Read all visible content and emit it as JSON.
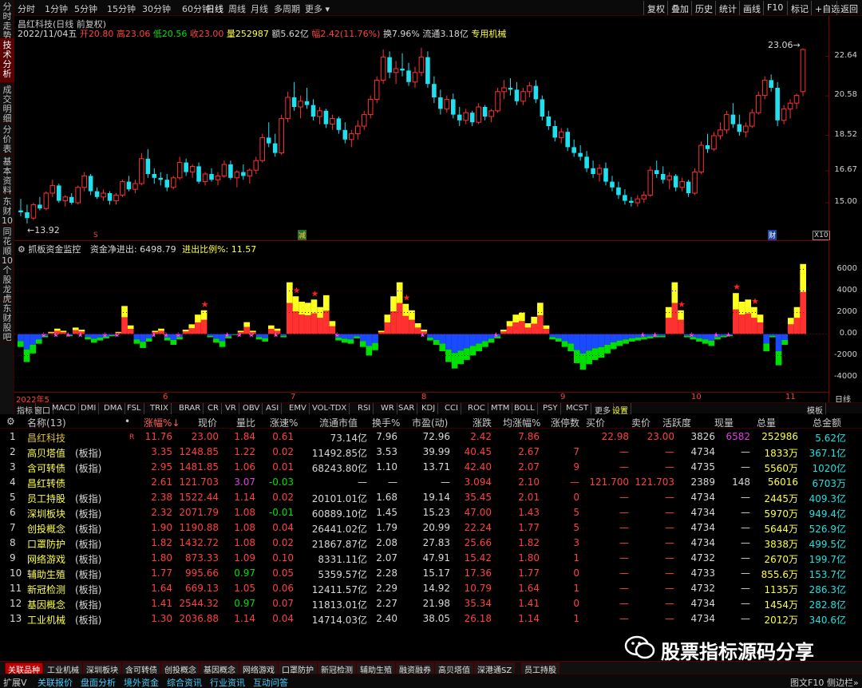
{
  "left_tabs": [
    "分时走势",
    "技术分析",
    "成交明细",
    "分价表",
    "基本资料",
    "东财10",
    "同花顺10",
    "个股龙虎",
    "东财股吧"
  ],
  "left_tab_active": 1,
  "toolbar": {
    "periods": [
      "分时",
      "1分钟",
      "5分钟",
      "15分钟",
      "30分钟",
      "60分钟",
      "日线",
      "周线",
      "月线",
      "多周期",
      "更多"
    ],
    "active_period": "日线",
    "right_buttons": [
      "复权",
      "叠加",
      "历史",
      "统计",
      "画线",
      "F10",
      "标记",
      "+自选",
      "返回"
    ]
  },
  "kline_info": {
    "title": "昌红科技(日线 前复权)",
    "date": "2022/11/04五",
    "open": "开20.80",
    "high": "高23.06",
    "low": "低20.56",
    "close": "收23.00",
    "volume": "量252987",
    "amount": "额5.62亿",
    "amp": "幅2.42(11.76%)",
    "turnover": "换7.96%",
    "float_cap": "流通3.18亿",
    "sector": "专用机械"
  },
  "kline_labels": {
    "max": "23.06",
    "min": "13.92",
    "x10": "X10",
    "mark_s": "S",
    "mark_jian": "减",
    "mark_cai": "财"
  },
  "price_ticks": [
    "22.64",
    "20.58",
    "18.52",
    "16.67",
    "15.00"
  ],
  "indicator": {
    "name": "抓板资金监控",
    "net_label": "资金净进出:",
    "net_value": "6498.79",
    "ratio_label": "进出比例%:",
    "ratio_value": "11.57",
    "ticks": [
      "6000",
      "4000",
      "2000",
      "0.00",
      "-2000",
      "-4000"
    ]
  },
  "time_axis": [
    "2022年5",
    "6",
    "7",
    "8",
    "9",
    "10",
    "11"
  ],
  "time_axis_right": "日线",
  "ind_tabs": [
    "指标",
    "窗口",
    "MACD",
    "DMI",
    "DMA",
    "FSL",
    "TRIX",
    "BRAR",
    "CR",
    "VR",
    "OBV",
    "ASI",
    "EMV",
    "VOL-TDX",
    "RSI",
    "WR",
    "SAR",
    "KDJ",
    "CCI",
    "ROC",
    "MTM",
    "BOLL",
    "PSY",
    "MCST",
    "更多",
    "设置"
  ],
  "ind_tab_right": "模板",
  "table": {
    "headers": [
      "名称(13)",
      "•",
      "涨幅%",
      "现价",
      "量比",
      "涨速%",
      "流通市值",
      "换手%",
      "市盈(动)",
      "涨跌",
      "均涨幅%",
      "涨停数",
      "买价",
      "卖价",
      "活跃度",
      "现量",
      "总量",
      "总金额"
    ],
    "rows": [
      [
        "1",
        "昌红科技",
        "R",
        "11.76",
        "23.00",
        "1.84",
        "0.61",
        "73.14亿",
        "7.96",
        "72.96",
        "2.42",
        "7.86",
        "",
        "22.98",
        "23.00",
        "3826",
        "6582",
        "252986",
        "5.62亿"
      ],
      [
        "2",
        "高贝塔值",
        "(板指)",
        "3.35",
        "1248.85",
        "1.22",
        "0.02",
        "11492.85亿",
        "3.53",
        "39.99",
        "40.45",
        "2.67",
        "7",
        "—",
        "—",
        "4734",
        "—",
        "1833万",
        "367.1亿"
      ],
      [
        "3",
        "含可转债",
        "(板指)",
        "2.95",
        "1481.85",
        "1.06",
        "0.01",
        "68243.80亿",
        "1.10",
        "13.71",
        "42.40",
        "2.07",
        "9",
        "—",
        "—",
        "4735",
        "—",
        "5560万",
        "1020亿"
      ],
      [
        "4",
        "昌红转债",
        "",
        "2.61",
        "121.703",
        "3.07",
        "-0.03",
        "—",
        "—",
        "—",
        "3.094",
        "2.10",
        "—",
        "121.700",
        "121.703",
        "2389",
        "148",
        "56016",
        "6703万"
      ],
      [
        "5",
        "员工持股",
        "(板指)",
        "2.38",
        "1522.44",
        "1.14",
        "0.02",
        "20101.01亿",
        "1.68",
        "19.14",
        "35.45",
        "2.01",
        "0",
        "—",
        "—",
        "4734",
        "—",
        "2445万",
        "409.3亿"
      ],
      [
        "6",
        "深圳板块",
        "(板指)",
        "2.32",
        "2071.79",
        "1.08",
        "-0.01",
        "60889.10亿",
        "1.45",
        "15.23",
        "47.00",
        "1.43",
        "5",
        "—",
        "—",
        "4734",
        "—",
        "5970万",
        "949.4亿"
      ],
      [
        "7",
        "创投概念",
        "(板指)",
        "1.90",
        "1190.88",
        "1.08",
        "0.04",
        "26441.02亿",
        "1.79",
        "20.99",
        "22.24",
        "1.77",
        "5",
        "—",
        "—",
        "4734",
        "—",
        "5644万",
        "526.9亿"
      ],
      [
        "8",
        "口罩防护",
        "(板指)",
        "1.82",
        "1432.72",
        "1.08",
        "0.02",
        "21867.87亿",
        "2.08",
        "27.83",
        "25.66",
        "1.82",
        "3",
        "—",
        "—",
        "4734",
        "—",
        "3838万",
        "499.5亿"
      ],
      [
        "9",
        "网络游戏",
        "(板指)",
        "1.80",
        "873.33",
        "1.09",
        "0.10",
        "8331.11亿",
        "2.07",
        "47.91",
        "15.42",
        "1.80",
        "1",
        "—",
        "—",
        "4732",
        "—",
        "2670万",
        "199.7亿"
      ],
      [
        "10",
        "辅助生殖",
        "(板指)",
        "1.77",
        "995.66",
        "0.97",
        "0.05",
        "5359.57亿",
        "2.28",
        "15.17",
        "17.36",
        "1.77",
        "0",
        "—",
        "—",
        "4733",
        "—",
        "855.6万",
        "153.7亿"
      ],
      [
        "11",
        "新冠检测",
        "(板指)",
        "1.64",
        "669.13",
        "1.05",
        "0.06",
        "12411.57亿",
        "2.29",
        "14.92",
        "10.79",
        "1.64",
        "1",
        "—",
        "—",
        "4732",
        "—",
        "1135万",
        "286.3亿"
      ],
      [
        "12",
        "基因概念",
        "(板指)",
        "1.41",
        "2544.32",
        "0.97",
        "0.07",
        "11813.01亿",
        "2.27",
        "21.98",
        "35.34",
        "1.41",
        "0",
        "—",
        "—",
        "4734",
        "—",
        "1454万",
        "282.8亿"
      ],
      [
        "13",
        "工业机械",
        "(板指)",
        "1.30",
        "2036.88",
        "1.14",
        "0.04",
        "14714.03亿",
        "2.40",
        "38.05",
        "26.18",
        "1.14",
        "1",
        "—",
        "—",
        "4734",
        "—",
        "2012万",
        "340.6亿"
      ]
    ]
  },
  "bottom_tabs": [
    "关联品种",
    "工业机械",
    "深圳板块",
    "含可转债",
    "创投概念",
    "基因概念",
    "网络游戏",
    "口罩防护",
    "新冠检测",
    "辅助生殖",
    "融资融券",
    "高贝塔值",
    "深港通SZ",
    "员工持股"
  ],
  "bottom_tab_active": "关联品种",
  "status_bar": [
    "扩展V",
    "关联报价",
    "盘面分析",
    "境外资金",
    "综合资讯",
    "行业资讯",
    "互动问答"
  ],
  "status_right": [
    "图文F10",
    "侧边栏»"
  ],
  "watermark": "股票指标源码分享",
  "colors": {
    "up": "#ff3030",
    "down": "#20e0f0",
    "red": "#ff3030",
    "yellow": "#ffff20",
    "green": "#00e000",
    "blue": "#1a4aff",
    "grid": "#7a0000"
  },
  "chart_data": {
    "type": "candlestick",
    "title": "昌红科技(日线 前复权)",
    "period": "2022/05 - 2022/11",
    "ylim": [
      13.5,
      23.5
    ],
    "candles": [
      [
        14.6,
        15.2,
        14.3,
        14.5
      ],
      [
        14.5,
        14.9,
        13.92,
        14.2
      ],
      [
        14.2,
        15.0,
        14.1,
        14.9
      ],
      [
        14.9,
        15.3,
        14.6,
        14.7
      ],
      [
        14.7,
        15.6,
        14.6,
        15.5
      ],
      [
        15.5,
        16.2,
        15.3,
        15.9
      ],
      [
        15.9,
        16.0,
        15.0,
        15.1
      ],
      [
        15.1,
        15.4,
        14.8,
        15.3
      ],
      [
        15.3,
        15.5,
        14.9,
        15.0
      ],
      [
        15.0,
        15.9,
        14.9,
        15.8
      ],
      [
        15.8,
        16.6,
        15.6,
        16.4
      ],
      [
        16.4,
        16.5,
        15.4,
        15.6
      ],
      [
        15.6,
        15.8,
        15.2,
        15.3
      ],
      [
        15.3,
        15.7,
        15.1,
        15.5
      ],
      [
        15.5,
        15.6,
        14.9,
        15.1
      ],
      [
        15.1,
        15.5,
        14.9,
        15.4
      ],
      [
        15.4,
        16.2,
        15.3,
        16.1
      ],
      [
        16.1,
        16.4,
        15.6,
        15.7
      ],
      [
        15.7,
        16.2,
        15.5,
        16.0
      ],
      [
        16.0,
        17.6,
        15.9,
        17.3
      ],
      [
        17.3,
        17.8,
        16.3,
        16.5
      ],
      [
        16.5,
        16.8,
        16.0,
        16.3
      ],
      [
        16.3,
        16.6,
        15.9,
        16.2
      ],
      [
        16.2,
        16.5,
        15.6,
        15.8
      ],
      [
        15.8,
        16.4,
        15.7,
        16.3
      ],
      [
        16.3,
        17.4,
        16.2,
        17.1
      ],
      [
        17.1,
        17.3,
        16.4,
        16.6
      ],
      [
        16.6,
        17.0,
        16.3,
        16.9
      ],
      [
        16.9,
        17.1,
        16.0,
        16.1
      ],
      [
        16.1,
        16.6,
        15.9,
        16.5
      ],
      [
        16.5,
        16.8,
        16.1,
        16.2
      ],
      [
        16.2,
        16.6,
        15.9,
        16.4
      ],
      [
        16.4,
        17.2,
        16.3,
        17.0
      ],
      [
        17.0,
        17.2,
        16.2,
        16.3
      ],
      [
        16.3,
        16.7,
        15.8,
        16.6
      ],
      [
        16.6,
        17.0,
        16.2,
        16.4
      ],
      [
        16.4,
        16.8,
        16.0,
        16.7
      ],
      [
        16.7,
        17.4,
        16.5,
        17.2
      ],
      [
        17.2,
        18.6,
        17.1,
        18.4
      ],
      [
        18.4,
        19.2,
        17.9,
        18.1
      ],
      [
        18.1,
        18.6,
        17.4,
        17.6
      ],
      [
        17.6,
        19.6,
        17.5,
        19.4
      ],
      [
        19.4,
        20.8,
        19.2,
        20.5
      ],
      [
        20.5,
        21.3,
        19.8,
        20.0
      ],
      [
        20.0,
        20.6,
        19.4,
        20.3
      ],
      [
        20.3,
        21.0,
        19.9,
        20.1
      ],
      [
        20.1,
        20.4,
        19.3,
        19.5
      ],
      [
        19.5,
        20.0,
        19.1,
        19.8
      ],
      [
        19.8,
        19.9,
        18.9,
        19.1
      ],
      [
        19.1,
        19.6,
        18.8,
        19.4
      ],
      [
        19.4,
        19.5,
        18.6,
        18.8
      ],
      [
        18.8,
        19.2,
        18.1,
        18.3
      ],
      [
        18.3,
        18.8,
        17.9,
        18.6
      ],
      [
        18.6,
        19.3,
        18.3,
        19.0
      ],
      [
        19.0,
        19.8,
        18.8,
        19.6
      ],
      [
        19.6,
        20.6,
        19.4,
        20.4
      ],
      [
        20.4,
        21.6,
        20.2,
        21.4
      ],
      [
        21.4,
        23.0,
        21.2,
        22.6
      ],
      [
        22.6,
        22.9,
        21.5,
        21.8
      ],
      [
        21.8,
        22.4,
        21.2,
        22.0
      ],
      [
        22.0,
        22.8,
        21.6,
        21.9
      ],
      [
        21.9,
        22.3,
        21.1,
        21.3
      ],
      [
        21.3,
        22.1,
        21.0,
        21.8
      ],
      [
        21.8,
        23.1,
        21.6,
        22.6
      ],
      [
        22.6,
        22.9,
        21.0,
        21.2
      ],
      [
        21.2,
        21.6,
        20.2,
        20.5
      ],
      [
        20.5,
        20.9,
        19.6,
        19.9
      ],
      [
        19.9,
        20.6,
        19.7,
        20.4
      ],
      [
        20.4,
        20.7,
        19.4,
        19.6
      ],
      [
        19.6,
        20.0,
        19.0,
        19.3
      ],
      [
        19.3,
        19.9,
        19.1,
        19.7
      ],
      [
        19.7,
        19.8,
        19.0,
        19.2
      ],
      [
        19.2,
        20.2,
        19.1,
        20.0
      ],
      [
        20.0,
        20.1,
        19.3,
        19.5
      ],
      [
        19.5,
        19.9,
        19.2,
        19.8
      ],
      [
        19.8,
        21.0,
        19.7,
        20.8
      ],
      [
        20.8,
        21.4,
        20.4,
        21.0
      ],
      [
        21.0,
        21.5,
        20.6,
        20.9
      ],
      [
        20.9,
        21.3,
        20.1,
        20.3
      ],
      [
        20.3,
        21.0,
        20.1,
        20.8
      ],
      [
        20.8,
        21.3,
        20.5,
        21.1
      ],
      [
        21.1,
        21.4,
        20.2,
        20.4
      ],
      [
        20.4,
        20.6,
        19.3,
        19.5
      ],
      [
        19.5,
        19.8,
        18.8,
        19.0
      ],
      [
        19.0,
        19.3,
        18.2,
        18.4
      ],
      [
        18.4,
        18.9,
        18.1,
        18.7
      ],
      [
        18.7,
        18.9,
        17.7,
        17.9
      ],
      [
        17.9,
        18.3,
        17.4,
        17.6
      ],
      [
        17.6,
        18.0,
        17.2,
        17.4
      ],
      [
        17.4,
        17.7,
        16.6,
        16.8
      ],
      [
        16.8,
        17.2,
        16.3,
        16.5
      ],
      [
        16.5,
        17.0,
        16.1,
        16.8
      ],
      [
        16.8,
        17.1,
        15.9,
        16.1
      ],
      [
        16.1,
        16.4,
        15.6,
        15.8
      ],
      [
        15.8,
        16.1,
        15.2,
        15.4
      ],
      [
        15.4,
        15.7,
        14.9,
        15.1
      ],
      [
        15.1,
        15.3,
        14.8,
        15.0
      ],
      [
        15.0,
        15.4,
        14.8,
        15.2
      ],
      [
        15.2,
        15.6,
        15.0,
        15.4
      ],
      [
        15.4,
        16.9,
        15.3,
        16.7
      ],
      [
        16.7,
        17.2,
        16.3,
        16.5
      ],
      [
        16.5,
        16.9,
        16.0,
        16.2
      ],
      [
        16.2,
        16.6,
        15.7,
        16.4
      ],
      [
        16.4,
        16.5,
        15.6,
        15.8
      ],
      [
        15.8,
        16.3,
        15.6,
        16.1
      ],
      [
        16.1,
        16.2,
        15.3,
        15.5
      ],
      [
        15.5,
        16.8,
        15.4,
        16.6
      ],
      [
        16.6,
        18.2,
        16.5,
        18.0
      ],
      [
        18.0,
        18.6,
        17.6,
        17.8
      ],
      [
        17.8,
        18.7,
        17.7,
        18.5
      ],
      [
        18.5,
        19.2,
        18.3,
        18.8
      ],
      [
        18.8,
        19.8,
        18.6,
        19.6
      ],
      [
        19.6,
        20.2,
        18.9,
        19.1
      ],
      [
        19.1,
        19.6,
        18.5,
        18.7
      ],
      [
        18.7,
        19.2,
        18.4,
        19.0
      ],
      [
        19.0,
        19.9,
        18.9,
        19.7
      ],
      [
        19.7,
        20.8,
        19.6,
        20.6
      ],
      [
        20.6,
        21.6,
        20.4,
        21.4
      ],
      [
        21.4,
        21.7,
        20.8,
        21.0
      ],
      [
        21.0,
        21.3,
        19.0,
        19.3
      ],
      [
        19.3,
        20.1,
        19.1,
        19.9
      ],
      [
        19.9,
        20.4,
        19.4,
        20.2
      ],
      [
        20.2,
        20.7,
        19.9,
        20.6
      ],
      [
        20.8,
        23.06,
        20.56,
        23.0
      ]
    ],
    "indicator_series": {
      "name": "资金净进出",
      "values": [
        -1200,
        -2600,
        -1800,
        -900,
        -300,
        200,
        500,
        300,
        -200,
        600,
        400,
        -500,
        -800,
        -600,
        -400,
        -200,
        200,
        2600,
        800,
        -900,
        -1300,
        -700,
        300,
        500,
        -600,
        -1000,
        -500,
        400,
        900,
        1800,
        2200,
        -300,
        -800,
        -1200,
        -400,
        -100,
        300,
        1100,
        300,
        -500,
        -700,
        800,
        500,
        -300,
        4800,
        3500,
        3000,
        2900,
        3200,
        2500,
        3600,
        1200,
        -600,
        -800,
        -900,
        -400,
        -1200,
        -2000,
        -1500,
        300,
        1800,
        3500,
        4800,
        2800,
        2200,
        1000,
        400,
        -600,
        -1000,
        -1600,
        -2600,
        -3200,
        -2800,
        -2400,
        -2000,
        -1600,
        -1200,
        -800,
        -400,
        400,
        1200,
        1800,
        2000,
        1000,
        1600,
        2900,
        800,
        -500,
        -700,
        -1200,
        -1600,
        -2700,
        -3300,
        -2800,
        -2400,
        -2200,
        -1800,
        -1400,
        -1100,
        -900,
        -700,
        -600,
        -500,
        -400,
        -300,
        -300,
        2500,
        4800,
        2200,
        -300,
        -500,
        -700,
        -900,
        -1100,
        -500,
        -300,
        -200,
        3800,
        3000,
        3200,
        2500,
        1800,
        -1600,
        -300,
        -2900,
        -1000,
        1500,
        2500,
        6498
      ]
    }
  }
}
